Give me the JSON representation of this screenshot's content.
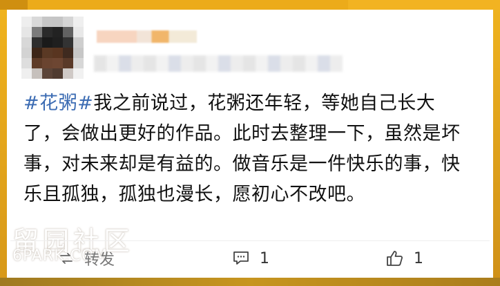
{
  "post": {
    "tag": "#花粥#",
    "text": "我之前说过，花粥还年轻，等她自己长大了，会做出更好的作品。此时去整理一下，虽然是坏事，对未来却是有益的。做音乐是一件快乐的事，快乐且孤独，孤独也漫长，愿初心不改吧。"
  },
  "actions": {
    "repost_label": "转发",
    "comment_count": "1",
    "like_count": "1"
  },
  "watermark": {
    "main": "留园社区",
    "sub": "6PARK.COM"
  },
  "icons": {
    "comment": "comment-icon",
    "like": "thumbs-up-icon",
    "repost": "repost-icon"
  },
  "colors": {
    "frame": "#e8a914",
    "tag": "#3c6cb3"
  }
}
